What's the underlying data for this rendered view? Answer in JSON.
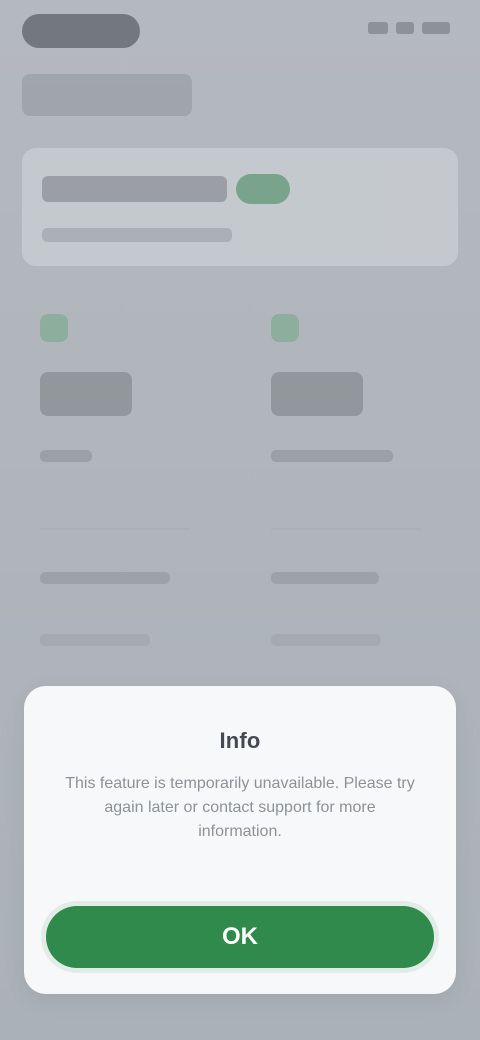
{
  "modal": {
    "title": "Info",
    "message": "This feature is temporarily unavailable. Please try again later or contact support for more information.",
    "button_label": "OK"
  },
  "colors": {
    "accent": "#2f8a4b",
    "badge": "#4c8f62",
    "background": "#aeb4ba",
    "modal_background": "#f8f9fa"
  }
}
